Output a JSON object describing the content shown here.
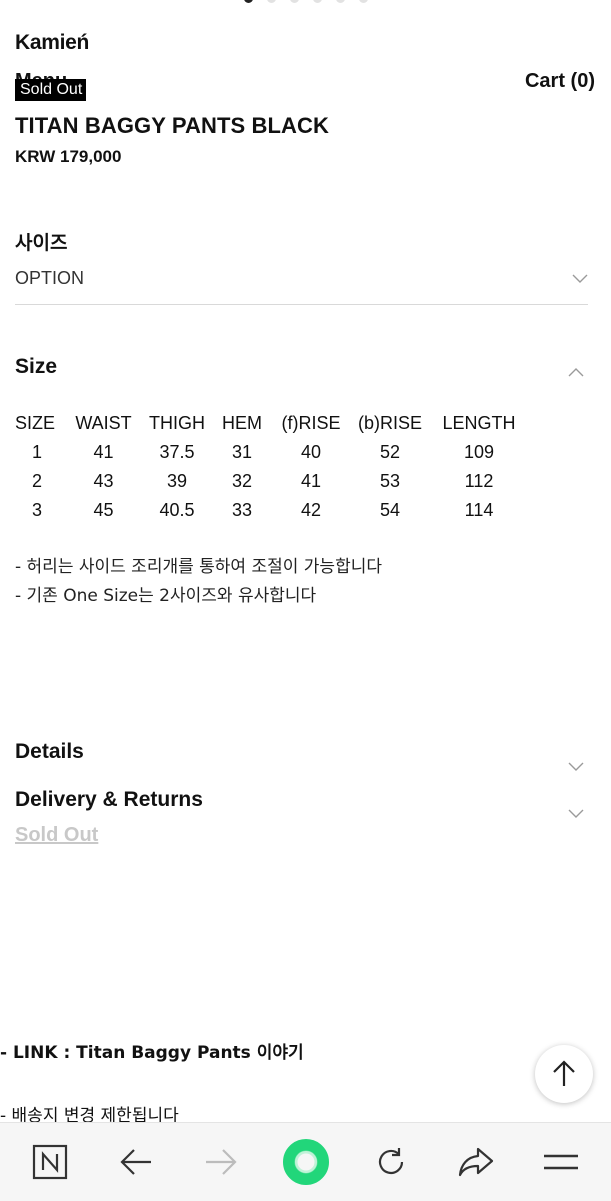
{
  "carousel": {
    "count": 6,
    "active": 0
  },
  "header": {
    "logo": "Kamień",
    "menu_label": "Menu",
    "sold_badge": "Sold Out",
    "cart_label": "Cart (0)"
  },
  "product": {
    "title": "TITAN BAGGY PANTS BLACK",
    "price": "KRW 179,000"
  },
  "option": {
    "label": "사이즈",
    "value": "OPTION"
  },
  "size_section": {
    "heading": "Size",
    "columns": [
      "SIZE",
      "WAIST",
      "THIGH",
      "HEM",
      "(f)RISE",
      "(b)RISE",
      "LENGTH"
    ],
    "rows": [
      [
        "1",
        "41",
        "37.5",
        "31",
        "40",
        "52",
        "109"
      ],
      [
        "2",
        "43",
        "39",
        "32",
        "41",
        "53",
        "112"
      ],
      [
        "3",
        "45",
        "40.5",
        "33",
        "42",
        "54",
        "114"
      ]
    ],
    "notes": [
      "- 허리는 사이드 조리개를 통하여 조절이 가능합니다",
      "- 기존 One Size는 2사이즈와 유사합니다"
    ]
  },
  "accordions": {
    "details": "Details",
    "delivery": "Delivery & Returns"
  },
  "sold_out_link": "Sold Out",
  "footer_text": {
    "link_line": "- LINK : Titan Baggy Pants 이야기",
    "shipping_line": "- 배송지 변경 제한됩니다"
  },
  "icons": {
    "brand": "naver-n-icon",
    "back": "arrow-left-icon",
    "forward": "arrow-right-icon",
    "home": "green-circle-icon",
    "reload": "reload-icon",
    "share": "share-icon",
    "menu": "hamburger-icon",
    "top": "arrow-up-icon"
  },
  "colors": {
    "badge_bg": "#000000",
    "sold_link": "#c8c8c8",
    "home_green": "#22d67a"
  }
}
